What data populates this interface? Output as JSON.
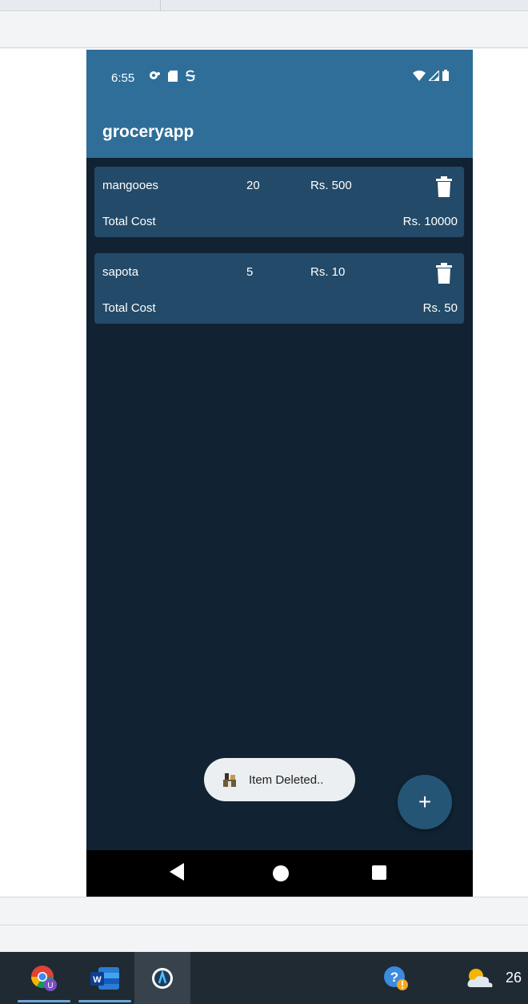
{
  "status_bar": {
    "time": "6:55"
  },
  "app": {
    "title": "groceryapp"
  },
  "items": [
    {
      "name": "mangooes",
      "quantity": "20",
      "price": "Rs. 500",
      "total_label": "Total Cost",
      "total_value": "Rs. 10000"
    },
    {
      "name": "sapota",
      "quantity": "5",
      "price": "Rs. 10",
      "total_label": "Total Cost",
      "total_value": "Rs. 50"
    }
  ],
  "toast": {
    "message": "Item Deleted.."
  },
  "fab": {
    "label": "+"
  },
  "taskbar": {
    "weather_temp": "26"
  },
  "icons": {
    "delete": "trash-icon",
    "nav": [
      "back-icon",
      "home-icon",
      "recents-icon"
    ],
    "taskbar": [
      "chrome-icon",
      "word-icon",
      "android-studio-icon",
      "help-icon",
      "weather-icon"
    ]
  },
  "colors": {
    "app_bar": "#2e6e99",
    "background": "#112233",
    "card": "#234a68",
    "fab": "#255574"
  }
}
